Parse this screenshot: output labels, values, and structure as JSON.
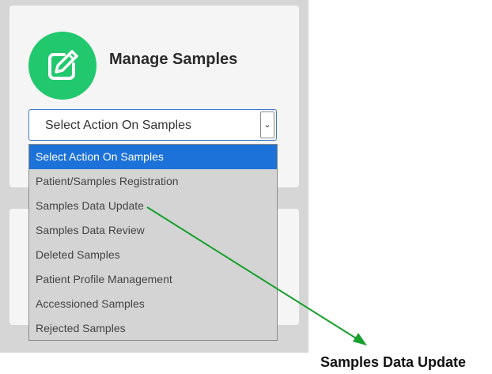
{
  "manage_card": {
    "title": "Manage Samples",
    "icon": "edit-icon",
    "badge_color": "#22c86e"
  },
  "action_select": {
    "value": "Select Action On Samples",
    "arrow_icon": "chevron-down-icon"
  },
  "action_options": [
    "Select Action On Samples",
    "Patient/Samples Registration",
    "Samples Data Update",
    "Samples Data Review",
    "Deleted Samples",
    "Patient Profile Management",
    "Accessioned Samples",
    "Rejected Samples"
  ],
  "highlight_color": "#1c72d8",
  "annotation": {
    "label": "Samples Data Update",
    "arrow_color": "#16a02c"
  }
}
